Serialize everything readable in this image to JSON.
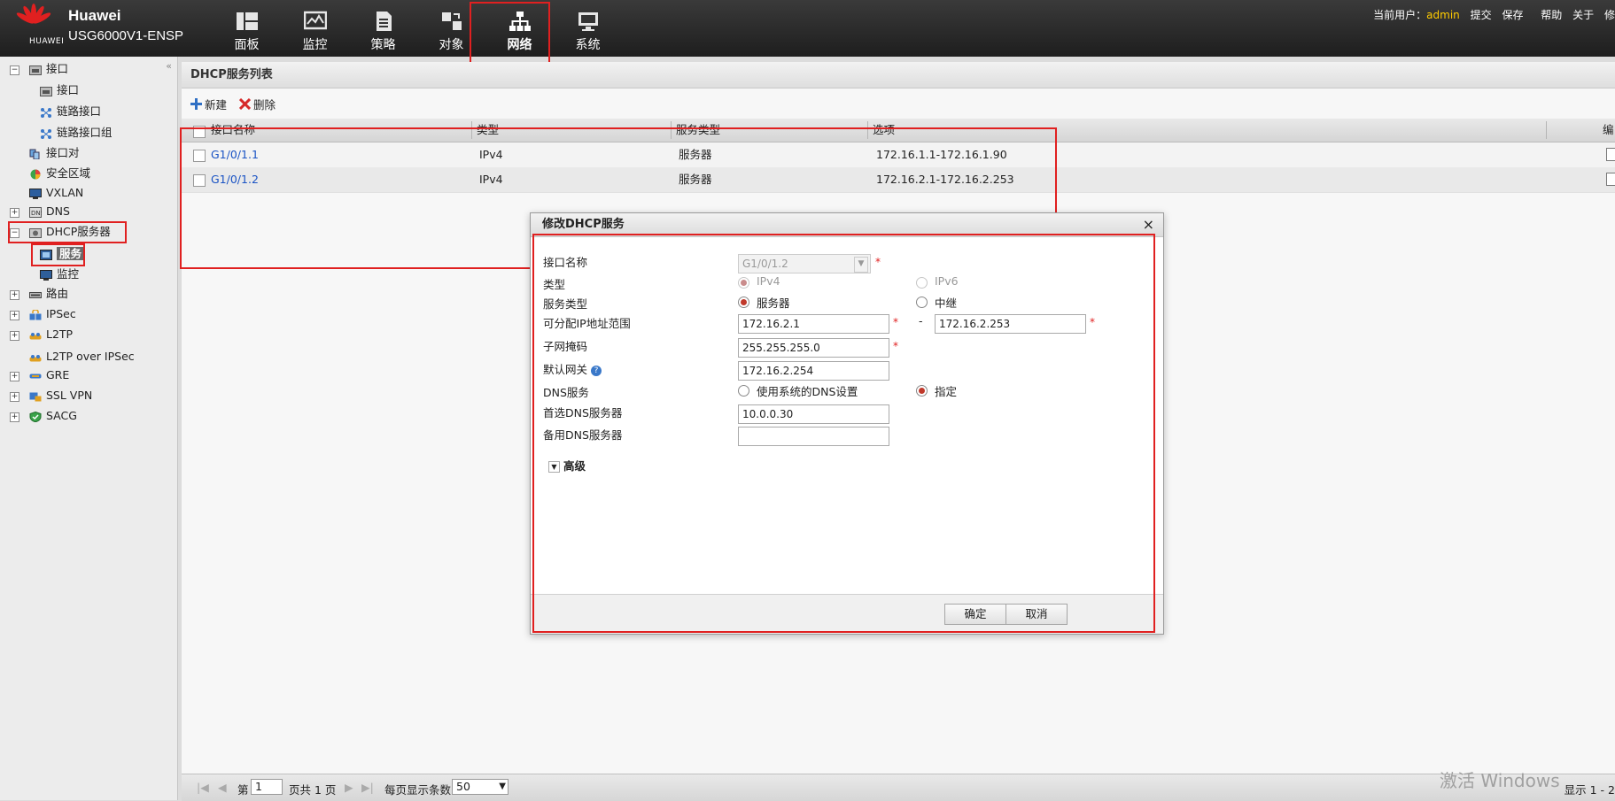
{
  "header": {
    "brand_top": "Huawei",
    "brand_model": "USG6000V1-ENSP",
    "logo_text": "HUAWEI",
    "nav": [
      {
        "label": "面板",
        "icon": "dashboard-icon"
      },
      {
        "label": "监控",
        "icon": "monitor-icon"
      },
      {
        "label": "策略",
        "icon": "policy-icon"
      },
      {
        "label": "对象",
        "icon": "object-icon"
      },
      {
        "label": "网络",
        "icon": "network-icon",
        "active": true
      },
      {
        "label": "系统",
        "icon": "system-icon"
      }
    ],
    "user_prefix": "当前用户：",
    "user": "admin",
    "submit": "提交",
    "save": "保存",
    "help": "帮助",
    "about": "关于",
    "logout_partial": "修"
  },
  "sidebar": {
    "items": [
      {
        "label": "接口",
        "expander": "−"
      },
      {
        "label": "接口"
      },
      {
        "label": "链路接口"
      },
      {
        "label": "链路接口组"
      },
      {
        "label": "接口对"
      },
      {
        "label": "安全区域"
      },
      {
        "label": "VXLAN"
      },
      {
        "label": "DNS",
        "expander": "+"
      },
      {
        "label": "DHCP服务器",
        "expander": "−"
      },
      {
        "label": "服务",
        "selected": true
      },
      {
        "label": "监控"
      },
      {
        "label": "路由",
        "expander": "+"
      },
      {
        "label": "IPSec",
        "expander": "+"
      },
      {
        "label": "L2TP",
        "expander": "+"
      },
      {
        "label": "L2TP over IPSec"
      },
      {
        "label": "GRE",
        "expander": "+"
      },
      {
        "label": "SSL VPN",
        "expander": "+"
      },
      {
        "label": "SACG",
        "expander": "+"
      }
    ]
  },
  "main": {
    "title": "DHCP服务列表",
    "toolbar": {
      "new": "新建",
      "delete": "删除"
    },
    "columns": [
      "接口名称",
      "类型",
      "服务类型",
      "选项",
      "编"
    ],
    "rows": [
      {
        "name": "G1/0/1.1",
        "type": "IPv4",
        "service": "服务器",
        "option": "172.16.1.1-172.16.1.90"
      },
      {
        "name": "G1/0/1.2",
        "type": "IPv4",
        "service": "服务器",
        "option": "172.16.2.1-172.16.2.253"
      }
    ]
  },
  "pager": {
    "page_prefix": "第",
    "page": "1",
    "page_suffix": "页共 1 页",
    "per_page_label": "每页显示条数",
    "per_page": "50",
    "display": "显示 1 - 2"
  },
  "watermark": "激活 Windows",
  "modal": {
    "title": "修改DHCP服务",
    "close": "×",
    "labels": {
      "iface": "接口名称",
      "type": "类型",
      "service_type": "服务类型",
      "ip_range": "可分配IP地址范围",
      "mask": "子网掩码",
      "gateway": "默认网关",
      "dns": "DNS服务",
      "dns1": "首选DNS服务器",
      "dns2": "备用DNS服务器",
      "advanced": "高级"
    },
    "values": {
      "iface": "G1/0/1.2",
      "ipv4": "IPv4",
      "ipv6": "IPv6",
      "server": "服务器",
      "relay": "中继",
      "range_start": "172.16.2.1",
      "range_sep": "-",
      "range_end": "172.16.2.253",
      "mask": "255.255.255.0",
      "gateway": "172.16.2.254",
      "dns_system": "使用系统的DNS设置",
      "dns_specify": "指定",
      "dns1": "10.0.0.30",
      "dns2": ""
    },
    "ok": "确定",
    "cancel": "取消"
  },
  "colors": {
    "accent_red": "#e02020",
    "radio_on": "#c0392b",
    "link": "#1a53c4",
    "admin": "#ffcc00"
  }
}
